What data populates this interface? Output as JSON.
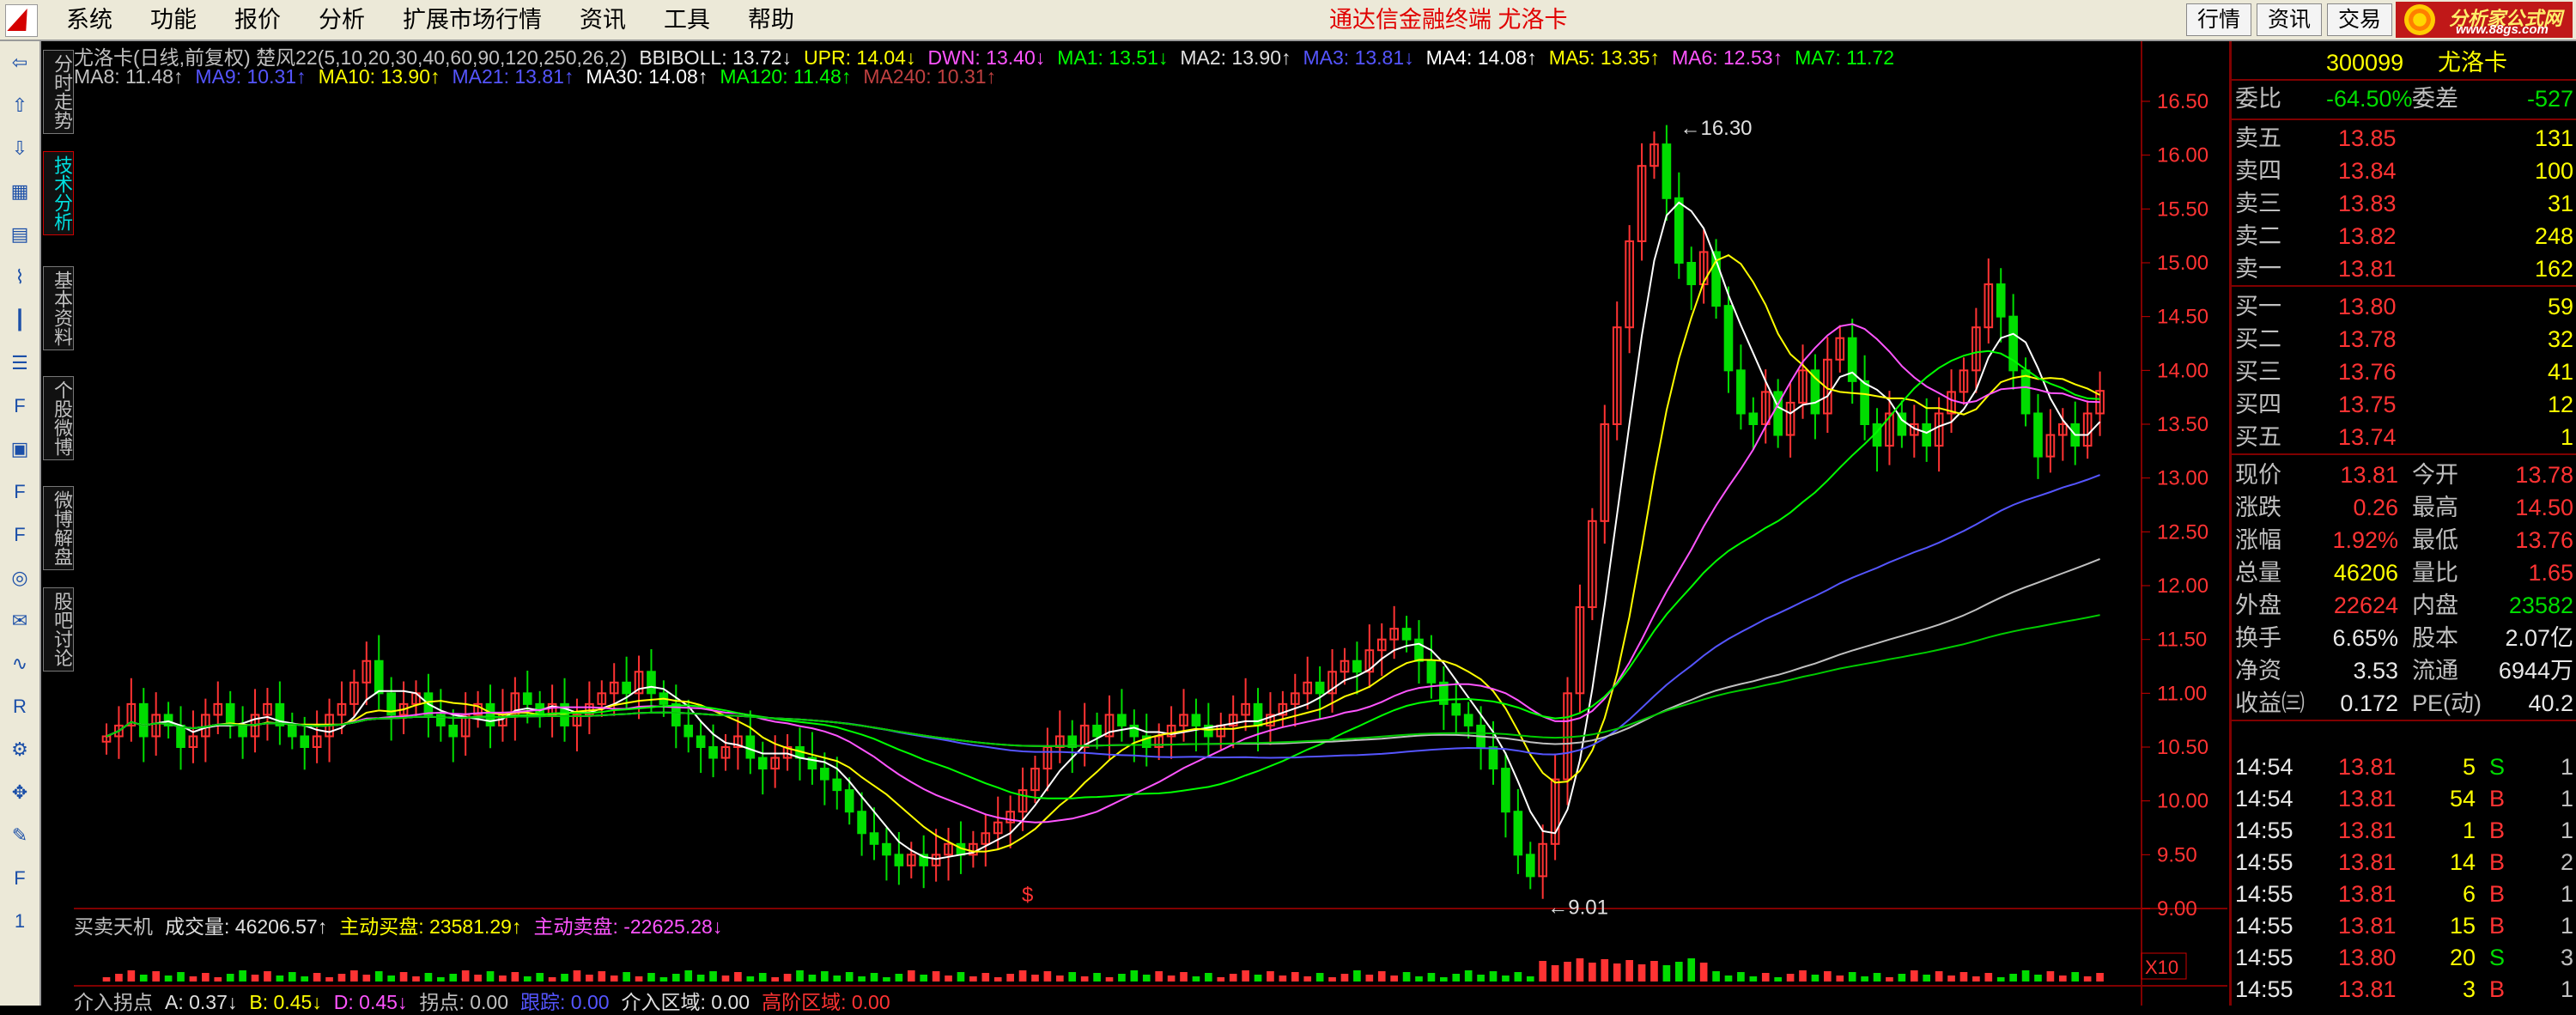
{
  "menu": [
    "系统",
    "功能",
    "报价",
    "分析",
    "扩展市场行情",
    "资讯",
    "工具",
    "帮助"
  ],
  "app_title": "通达信金融终端   尤洛卡",
  "top_buttons": [
    "行情",
    "资讯",
    "交易"
  ],
  "site_badge": {
    "name": "分析家公式网",
    "url": "www.88gs.com"
  },
  "side_tabs": [
    "分时走势",
    "技术分析",
    "基本资料",
    "个股微博",
    "微博解盘",
    "股吧讨论"
  ],
  "toolbar_icons": [
    "back-arrow-icon",
    "up-arrow-icon",
    "down-arrow-icon",
    "grid-icon",
    "table-icon",
    "line-chart-icon",
    "candle-icon",
    "list-icon",
    "f10-icon",
    "calendar-icon",
    "F11-icon",
    "F12-icon",
    "search-icon",
    "message-icon",
    "wave-icon",
    "rsi-icon",
    "settings-icon",
    "move-icon",
    "pencil-icon",
    "f5-icon",
    "number-one-icon"
  ],
  "legend1": [
    {
      "text": "尤洛卡(日线,前复权) 楚风22(5,10,20,30,40,60,90,120,250,26,2)",
      "color": "#c0c0c0"
    },
    {
      "text": "BBIBOLL: 13.72↓",
      "color": "#e8e8e8"
    },
    {
      "text": "UPR: 14.04↓",
      "color": "#ffff00"
    },
    {
      "text": "DWN: 13.40↓",
      "color": "#ff55ff"
    },
    {
      "text": "MA1: 13.51↓",
      "color": "#00ff00"
    },
    {
      "text": "MA2: 13.90↑",
      "color": "#e0e0e0"
    },
    {
      "text": "MA3: 13.81↓",
      "color": "#5555ff"
    },
    {
      "text": "MA4: 14.08↑",
      "color": "#ffffff"
    },
    {
      "text": "MA5: 13.35↑",
      "color": "#ffff00"
    },
    {
      "text": "MA6: 12.53↑",
      "color": "#ff55ff"
    },
    {
      "text": "MA7: 11.72",
      "color": "#00ff00"
    }
  ],
  "legend2": [
    {
      "text": "MA8: 11.48↑",
      "color": "#c0c0c0"
    },
    {
      "text": "MA9: 10.31↑",
      "color": "#5555ff"
    },
    {
      "text": "MA10: 13.90↑",
      "color": "#ffff00"
    },
    {
      "text": "MA21: 13.81↑",
      "color": "#5555ff"
    },
    {
      "text": "MA30: 14.08↑",
      "color": "#ffffff"
    },
    {
      "text": "MA120: 11.48↑",
      "color": "#00ff00"
    },
    {
      "text": "MA240: 10.31↑",
      "color": "#c04040"
    }
  ],
  "legend3": [
    {
      "text": "买卖天机",
      "color": "#c0c0c0"
    },
    {
      "text": "成交量: 46206.57↑",
      "color": "#e0e0e0"
    },
    {
      "text": "主动买盘: 23581.29↑",
      "color": "#ffff00"
    },
    {
      "text": "主动卖盘: -22625.28↓",
      "color": "#ff55ff"
    }
  ],
  "legend4": [
    {
      "text": "介入拐点",
      "color": "#c0c0c0"
    },
    {
      "text": "A: 0.37↓",
      "color": "#e0e0e0"
    },
    {
      "text": "B: 0.45↓",
      "color": "#ffff00"
    },
    {
      "text": "D: 0.45↓",
      "color": "#ff55ff"
    },
    {
      "text": "拐点: 0.00",
      "color": "#c0c0c0"
    },
    {
      "text": "跟踪: 0.00",
      "color": "#5555ff"
    },
    {
      "text": "介入区域: 0.00",
      "color": "#e0e0e0"
    },
    {
      "text": "高阶区域: 0.00",
      "color": "#ff3333"
    }
  ],
  "price_axis": [
    "16.50",
    "16.00",
    "15.50",
    "15.00",
    "14.50",
    "14.00",
    "13.50",
    "13.00",
    "12.50",
    "12.00",
    "11.50",
    "11.00",
    "10.50",
    "10.00",
    "9.50",
    "9.00"
  ],
  "annotations": {
    "high": "16.30",
    "low": "9.01",
    "volume_scale": "X10",
    "dollar": "$"
  },
  "chart_data": {
    "type": "candlestick",
    "ylim": [
      9.0,
      16.5
    ],
    "y_ticks": [
      9.0,
      9.5,
      10.0,
      10.5,
      11.0,
      11.5,
      12.0,
      12.5,
      13.0,
      13.5,
      14.0,
      14.5,
      15.0,
      15.5,
      16.0,
      16.5
    ],
    "close": [
      10.6,
      10.7,
      10.9,
      10.6,
      10.8,
      10.7,
      10.5,
      10.6,
      10.8,
      10.9,
      10.7,
      10.6,
      10.8,
      10.9,
      10.7,
      10.6,
      10.5,
      10.6,
      10.8,
      10.9,
      11.1,
      11.3,
      11.0,
      10.8,
      10.9,
      11.0,
      10.8,
      10.7,
      10.6,
      10.8,
      10.9,
      10.7,
      10.8,
      11.0,
      10.9,
      10.8,
      10.9,
      10.7,
      10.8,
      10.9,
      11.0,
      11.1,
      11.0,
      11.2,
      11.0,
      10.9,
      10.7,
      10.6,
      10.5,
      10.4,
      10.5,
      10.6,
      10.4,
      10.3,
      10.4,
      10.5,
      10.4,
      10.3,
      10.2,
      10.1,
      9.9,
      9.7,
      9.6,
      9.5,
      9.4,
      9.5,
      9.4,
      9.5,
      9.6,
      9.5,
      9.6,
      9.7,
      9.8,
      9.9,
      10.1,
      10.3,
      10.5,
      10.6,
      10.5,
      10.7,
      10.6,
      10.8,
      10.7,
      10.6,
      10.5,
      10.6,
      10.7,
      10.8,
      10.7,
      10.6,
      10.7,
      10.8,
      10.9,
      10.7,
      10.8,
      10.9,
      11.0,
      11.1,
      11.0,
      11.2,
      11.3,
      11.2,
      11.4,
      11.5,
      11.6,
      11.5,
      11.3,
      11.1,
      10.9,
      10.8,
      10.7,
      10.5,
      10.3,
      9.9,
      9.5,
      9.3,
      9.6,
      10.2,
      11.0,
      11.8,
      12.6,
      13.5,
      14.4,
      15.2,
      15.9,
      16.1,
      15.6,
      15.0,
      14.8,
      15.1,
      14.6,
      14.0,
      13.6,
      13.5,
      13.8,
      13.4,
      13.7,
      14.0,
      13.6,
      14.1,
      14.3,
      13.9,
      13.5,
      13.3,
      13.6,
      13.4,
      13.5,
      13.3,
      13.6,
      13.8,
      14.0,
      14.4,
      14.8,
      14.5,
      14.0,
      13.6,
      13.2,
      13.4,
      13.5,
      13.3,
      13.6,
      13.81
    ],
    "daily_quote": {
      "code": "300099",
      "name": "尤洛卡",
      "price": 13.81,
      "change": 0.26,
      "change_pct": 1.92,
      "open": 13.78,
      "high": 14.5,
      "low": 13.76
    }
  },
  "quote": {
    "code": "300099",
    "name": "尤洛卡",
    "ratio": [
      {
        "label": "委比",
        "value": "-64.50%",
        "cls": "grn"
      },
      {
        "label": "委差",
        "value": "-527",
        "cls": "grn"
      }
    ],
    "sells": [
      {
        "label": "卖五",
        "price": "13.85",
        "vol": "131"
      },
      {
        "label": "卖四",
        "price": "13.84",
        "vol": "100"
      },
      {
        "label": "卖三",
        "price": "13.83",
        "vol": "31"
      },
      {
        "label": "卖二",
        "price": "13.82",
        "vol": "248"
      },
      {
        "label": "卖一",
        "price": "13.81",
        "vol": "162"
      }
    ],
    "buys": [
      {
        "label": "买一",
        "price": "13.80",
        "vol": "59"
      },
      {
        "label": "买二",
        "price": "13.78",
        "vol": "32"
      },
      {
        "label": "买三",
        "price": "13.76",
        "vol": "41"
      },
      {
        "label": "买四",
        "price": "13.75",
        "vol": "12"
      },
      {
        "label": "买五",
        "price": "13.74",
        "vol": "1"
      }
    ],
    "stats": [
      [
        {
          "label": "现价",
          "value": "13.81",
          "cls": "red"
        },
        {
          "label": "今开",
          "value": "13.78",
          "cls": "red"
        }
      ],
      [
        {
          "label": "涨跌",
          "value": "0.26",
          "cls": "red"
        },
        {
          "label": "最高",
          "value": "14.50",
          "cls": "red"
        }
      ],
      [
        {
          "label": "涨幅",
          "value": "1.92%",
          "cls": "red"
        },
        {
          "label": "最低",
          "value": "13.76",
          "cls": "red"
        }
      ],
      [
        {
          "label": "总量",
          "value": "46206",
          "cls": "yel"
        },
        {
          "label": "量比",
          "value": "1.65",
          "cls": "red"
        }
      ],
      [
        {
          "label": "外盘",
          "value": "22624",
          "cls": "red"
        },
        {
          "label": "内盘",
          "value": "23582",
          "cls": "grn"
        }
      ],
      [
        {
          "label": "换手",
          "value": "6.65%",
          "cls": "wht"
        },
        {
          "label": "股本",
          "value": "2.07亿",
          "cls": "wht"
        }
      ],
      [
        {
          "label": "净资",
          "value": "3.53",
          "cls": "wht"
        },
        {
          "label": "流通",
          "value": "6944万",
          "cls": "wht"
        }
      ],
      [
        {
          "label": "收益㈢",
          "value": "0.172",
          "cls": "wht"
        },
        {
          "label": "PE(动)",
          "value": "40.2",
          "cls": "wht"
        }
      ]
    ],
    "ticks": [
      {
        "time": "14:54",
        "price": "13.81",
        "vol": "5",
        "side": "S",
        "n": "1"
      },
      {
        "time": "14:54",
        "price": "13.81",
        "vol": "54",
        "side": "B",
        "n": "1"
      },
      {
        "time": "14:55",
        "price": "13.81",
        "vol": "1",
        "side": "B",
        "n": "1"
      },
      {
        "time": "14:55",
        "price": "13.81",
        "vol": "14",
        "side": "B",
        "n": "2"
      },
      {
        "time": "14:55",
        "price": "13.81",
        "vol": "6",
        "side": "B",
        "n": "1"
      },
      {
        "time": "14:55",
        "price": "13.81",
        "vol": "15",
        "side": "B",
        "n": "1"
      },
      {
        "time": "14:55",
        "price": "13.80",
        "vol": "20",
        "side": "S",
        "n": "3"
      },
      {
        "time": "14:55",
        "price": "13.81",
        "vol": "3",
        "side": "B",
        "n": "1"
      }
    ]
  }
}
